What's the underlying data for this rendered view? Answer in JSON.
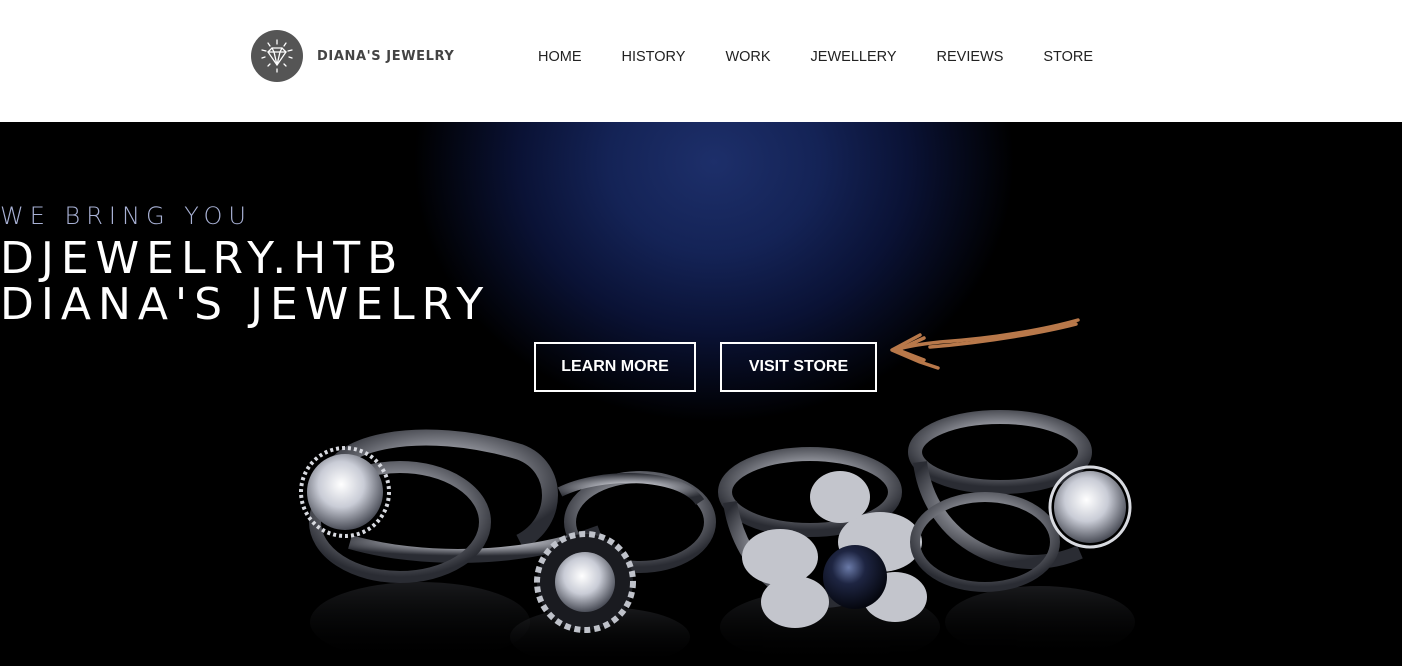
{
  "header": {
    "brand_name": "DIANA'S JEWELRY",
    "nav": [
      "HOME",
      "HISTORY",
      "WORK",
      "JEWELLERY",
      "REVIEWS",
      "STORE"
    ]
  },
  "hero": {
    "kicker": "WE BRING YOU",
    "title_line1": "DJEWELRY.HTB",
    "title_line2": "DIANA'S JEWELRY",
    "learn_more_label": "LEARN MORE",
    "visit_store_label": "VISIT STORE",
    "annotation_arrow_color": "#b8784a"
  },
  "colors": {
    "logo_badge": "#555555",
    "hero_glow": "#1d2f6a",
    "kicker_text": "#a9b2d6"
  }
}
